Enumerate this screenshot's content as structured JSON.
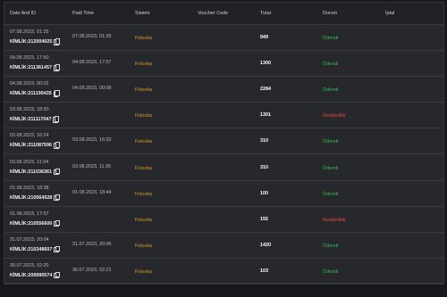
{
  "headers": {
    "date_and_id": "Date And ID",
    "paid_time": "Paid Time",
    "sistem": "Sistem",
    "voucher_code": "Voucher Code",
    "tutar": "Tutar",
    "durum": "Durum",
    "iptal": "İptal"
  },
  "rows": [
    {
      "date": "07.08.2023, 01:25",
      "kimlik": "KİMLİK:212004025",
      "paid_time": "07.08.2023, 01:35",
      "sistem": "Fixturka",
      "voucher": "",
      "tutar": "949",
      "durum": "Ödendi",
      "status": "paid"
    },
    {
      "date": "04.08.2023, 17:50",
      "kimlik": "KİMLİK:211361457",
      "paid_time": "04.08.2023, 17:57",
      "sistem": "Fixturka",
      "voucher": "",
      "tutar": "1300",
      "durum": "Ödendi",
      "status": "paid"
    },
    {
      "date": "04.08.2023, 00:02",
      "kimlik": "KİMLİK:211190435",
      "paid_time": "04.08.2023, 00:08",
      "sistem": "Fixturka",
      "voucher": "",
      "tutar": "2284",
      "durum": "Ödendi",
      "status": "paid"
    },
    {
      "date": "03.08.2023, 18:50",
      "kimlik": "KİMLİK:211117047",
      "paid_time": "",
      "sistem": "Fixturka",
      "voucher": "",
      "tutar": "1301",
      "durum": "Reddedildi",
      "status": "rejected"
    },
    {
      "date": "03.08.2023, 16:24",
      "kimlik": "KİMLİK:211087596",
      "paid_time": "03.08.2023, 16:32",
      "sistem": "Fixturka",
      "voucher": "",
      "tutar": "310",
      "durum": "Ödendi",
      "status": "paid"
    },
    {
      "date": "03.08.2023, 11:34",
      "kimlik": "KİMLİK:211036361",
      "paid_time": "03.08.2023, 11:35",
      "sistem": "Fixturka",
      "voucher": "",
      "tutar": "310",
      "durum": "Ödendi",
      "status": "paid"
    },
    {
      "date": "01.08.2023, 18:38",
      "kimlik": "KİMLİK:210564528",
      "paid_time": "01.08.2023, 18:44",
      "sistem": "Fixturka",
      "voucher": "",
      "tutar": "100",
      "durum": "Ödendi",
      "status": "paid"
    },
    {
      "date": "01.08.2023, 17:57",
      "kimlik": "KİMLİK:210556600",
      "paid_time": "",
      "sistem": "Fixturka",
      "voucher": "",
      "tutar": "155",
      "durum": "Reddedildi",
      "status": "rejected"
    },
    {
      "date": "31.07.2023, 20:04",
      "kimlik": "KİMLİK:210348607",
      "paid_time": "31.07.2023, 20:06",
      "sistem": "Fixturka",
      "voucher": "",
      "tutar": "1420",
      "durum": "Ödendi",
      "status": "paid"
    },
    {
      "date": "30.07.2023, 02:20",
      "kimlik": "KİMLİK:209990574",
      "paid_time": "30.07.2023, 02:21",
      "sistem": "Fixturka",
      "voucher": "",
      "tutar": "103",
      "durum": "Ödendi",
      "status": "paid"
    }
  ],
  "colors": {
    "background": "#17181b",
    "panel": "#26282c",
    "sistem": "#d79a2c",
    "paid": "#35b84f",
    "rejected": "#e04545"
  },
  "icons": [
    "copy-icon"
  ]
}
